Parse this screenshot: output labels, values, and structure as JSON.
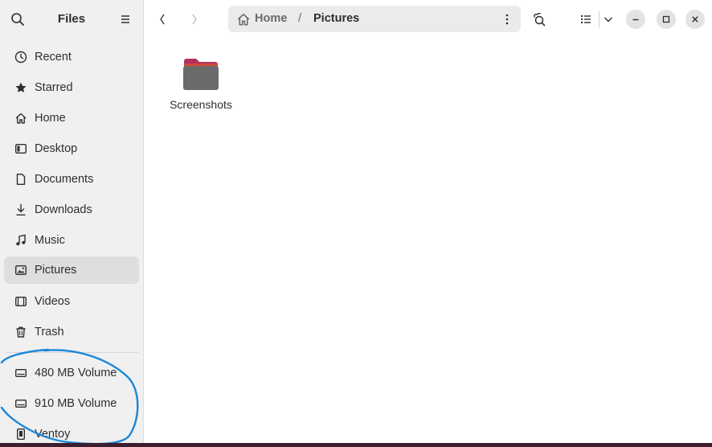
{
  "sidebar": {
    "title": "Files",
    "items": [
      {
        "label": "Recent",
        "icon": "clock-icon"
      },
      {
        "label": "Starred",
        "icon": "star-icon"
      },
      {
        "label": "Home",
        "icon": "home-icon"
      },
      {
        "label": "Desktop",
        "icon": "desktop-icon"
      },
      {
        "label": "Documents",
        "icon": "document-icon"
      },
      {
        "label": "Downloads",
        "icon": "download-icon"
      },
      {
        "label": "Music",
        "icon": "music-icon"
      },
      {
        "label": "Pictures",
        "icon": "pictures-icon",
        "active": true
      },
      {
        "label": "Videos",
        "icon": "video-icon"
      },
      {
        "label": "Trash",
        "icon": "trash-icon"
      }
    ],
    "devices": [
      {
        "label": "480 MB Volume",
        "icon": "drive-icon"
      },
      {
        "label": "910 MB Volume",
        "icon": "drive-icon"
      },
      {
        "label": "Ventoy",
        "icon": "usb-drive-icon"
      }
    ]
  },
  "header": {
    "path": {
      "home": "Home",
      "separator": "/",
      "current": "Pictures"
    }
  },
  "content": {
    "items": [
      {
        "name": "Screenshots",
        "type": "folder"
      }
    ]
  },
  "colors": {
    "accent_folder_top": "#c2386a",
    "folder_body": "#6b6b6b",
    "annotation_stroke": "#1b87d8",
    "active_item_bg": "#dedede"
  }
}
